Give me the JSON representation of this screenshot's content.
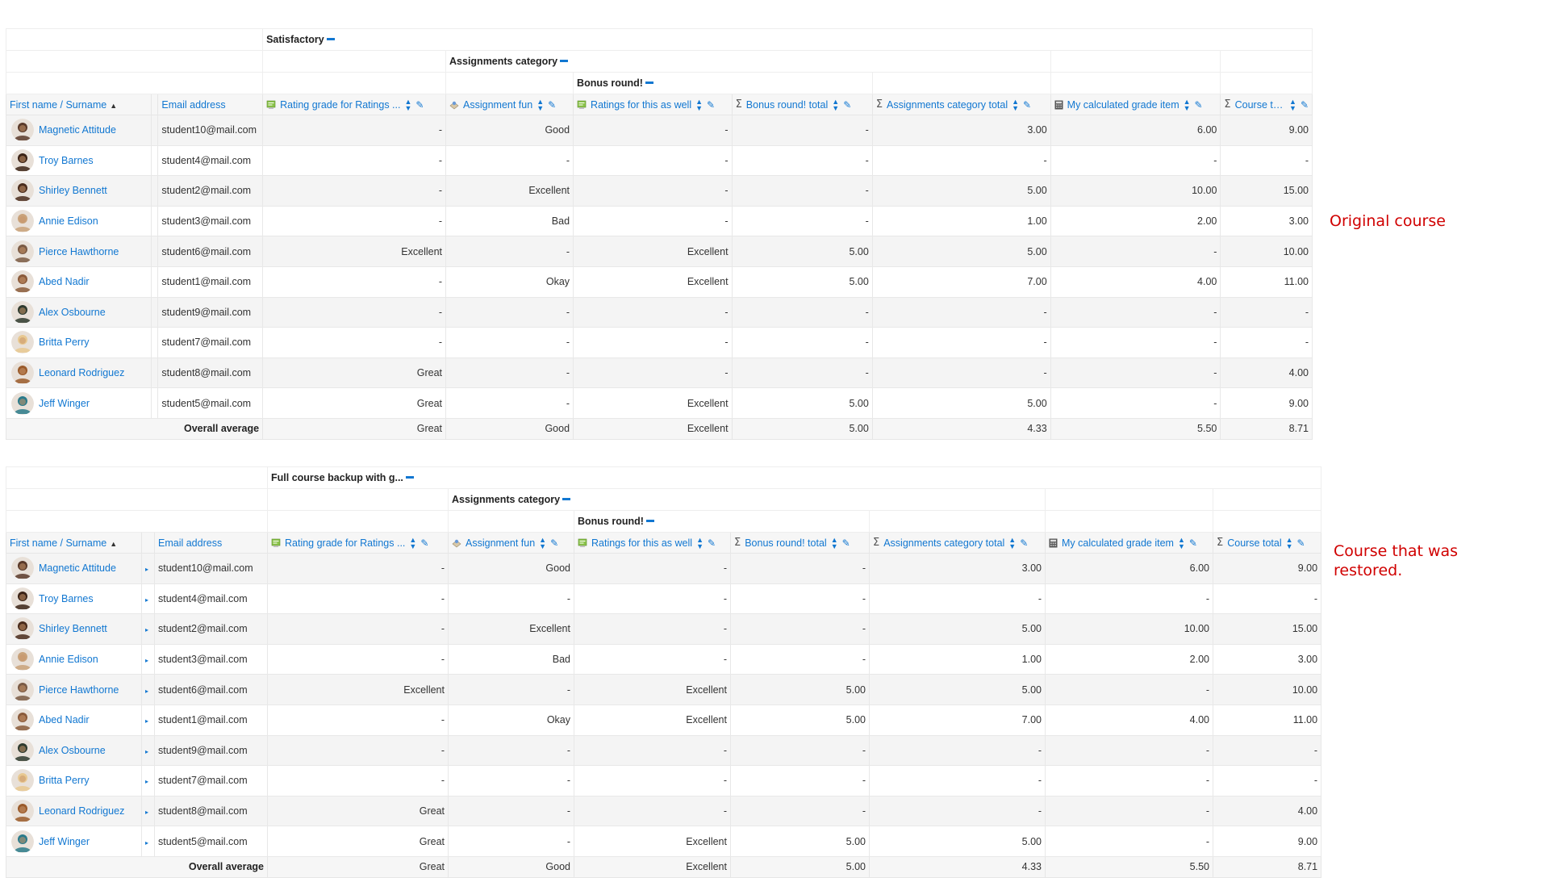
{
  "tables": [
    {
      "category_top": "Satisfactory",
      "category_mid": "Assignments category",
      "category_inner": "Bonus round!",
      "header_name": "First name / Surname",
      "header_email": "Email address",
      "columns": [
        "Rating grade for Ratings ...",
        "Assignment fun",
        "Ratings for this as well",
        "Bonus round! total",
        "Assignments category total",
        "My calculated grade item",
        "Course total"
      ],
      "average_label": "Overall average",
      "averages": [
        "Great",
        "Good",
        "Excellent",
        "5.00",
        "4.33",
        "5.50",
        "8.71"
      ],
      "note": "Original course",
      "rows": [
        {
          "name": "Magnetic Attitude",
          "email": "student10@mail.com",
          "grades": [
            "-",
            "Good",
            "-",
            "-",
            "3.00",
            "6.00",
            "9.00"
          ]
        },
        {
          "name": "Troy Barnes",
          "email": "student4@mail.com",
          "grades": [
            "-",
            "-",
            "-",
            "-",
            "-",
            "-",
            "-"
          ]
        },
        {
          "name": "Shirley Bennett",
          "email": "student2@mail.com",
          "grades": [
            "-",
            "Excellent",
            "-",
            "-",
            "5.00",
            "10.00",
            "15.00"
          ]
        },
        {
          "name": "Annie Edison",
          "email": "student3@mail.com",
          "grades": [
            "-",
            "Bad",
            "-",
            "-",
            "1.00",
            "2.00",
            "3.00"
          ]
        },
        {
          "name": "Pierce Hawthorne",
          "email": "student6@mail.com",
          "grades": [
            "Excellent",
            "-",
            "Excellent",
            "5.00",
            "5.00",
            "-",
            "10.00"
          ]
        },
        {
          "name": "Abed Nadir",
          "email": "student1@mail.com",
          "grades": [
            "-",
            "Okay",
            "Excellent",
            "5.00",
            "7.00",
            "4.00",
            "11.00"
          ]
        },
        {
          "name": "Alex Osbourne",
          "email": "student9@mail.com",
          "grades": [
            "-",
            "-",
            "-",
            "-",
            "-",
            "-",
            "-"
          ]
        },
        {
          "name": "Britta Perry",
          "email": "student7@mail.com",
          "grades": [
            "-",
            "-",
            "-",
            "-",
            "-",
            "-",
            "-"
          ]
        },
        {
          "name": "Leonard Rodriguez",
          "email": "student8@mail.com",
          "grades": [
            "Great",
            "-",
            "-",
            "-",
            "-",
            "-",
            "4.00"
          ]
        },
        {
          "name": "Jeff Winger",
          "email": "student5@mail.com",
          "grades": [
            "Great",
            "-",
            "Excellent",
            "5.00",
            "5.00",
            "-",
            "9.00"
          ]
        }
      ]
    },
    {
      "category_top": "Full course backup with g...",
      "category_mid": "Assignments category",
      "category_inner": "Bonus round!",
      "header_name": "First name / Surname",
      "header_email": "Email address",
      "columns": [
        "Rating grade for Ratings ...",
        "Assignment fun",
        "Ratings for this as well",
        "Bonus round! total",
        "Assignments category total",
        "My calculated grade item",
        "Course total"
      ],
      "average_label": "Overall average",
      "averages": [
        "Great",
        "Good",
        "Excellent",
        "5.00",
        "4.33",
        "5.50",
        "8.71"
      ],
      "note": "Course that was restored.",
      "rows": [
        {
          "name": "Magnetic Attitude",
          "email": "student10@mail.com",
          "grades": [
            "-",
            "Good",
            "-",
            "-",
            "3.00",
            "6.00",
            "9.00"
          ]
        },
        {
          "name": "Troy Barnes",
          "email": "student4@mail.com",
          "grades": [
            "-",
            "-",
            "-",
            "-",
            "-",
            "-",
            "-"
          ]
        },
        {
          "name": "Shirley Bennett",
          "email": "student2@mail.com",
          "grades": [
            "-",
            "Excellent",
            "-",
            "-",
            "5.00",
            "10.00",
            "15.00"
          ]
        },
        {
          "name": "Annie Edison",
          "email": "student3@mail.com",
          "grades": [
            "-",
            "Bad",
            "-",
            "-",
            "1.00",
            "2.00",
            "3.00"
          ]
        },
        {
          "name": "Pierce Hawthorne",
          "email": "student6@mail.com",
          "grades": [
            "Excellent",
            "-",
            "Excellent",
            "5.00",
            "5.00",
            "-",
            "10.00"
          ]
        },
        {
          "name": "Abed Nadir",
          "email": "student1@mail.com",
          "grades": [
            "-",
            "Okay",
            "Excellent",
            "5.00",
            "7.00",
            "4.00",
            "11.00"
          ]
        },
        {
          "name": "Alex Osbourne",
          "email": "student9@mail.com",
          "grades": [
            "-",
            "-",
            "-",
            "-",
            "-",
            "-",
            "-"
          ]
        },
        {
          "name": "Britta Perry",
          "email": "student7@mail.com",
          "grades": [
            "-",
            "-",
            "-",
            "-",
            "-",
            "-",
            "-"
          ]
        },
        {
          "name": "Leonard Rodriguez",
          "email": "student8@mail.com",
          "grades": [
            "Great",
            "-",
            "-",
            "-",
            "-",
            "-",
            "4.00"
          ]
        },
        {
          "name": "Jeff Winger",
          "email": "student5@mail.com",
          "grades": [
            "Great",
            "-",
            "Excellent",
            "5.00",
            "5.00",
            "-",
            "9.00"
          ]
        }
      ]
    }
  ],
  "avatar_colors": [
    "#5a3a2a",
    "#3b2316",
    "#4a2c1c",
    "#c9a27a",
    "#7a5a44",
    "#8a5a3a",
    "#2e3a2e",
    "#e8c890",
    "#9a5a2a",
    "#2a7a8a"
  ],
  "column_icons": [
    "rating-icon",
    "assignment-icon",
    "rating-icon",
    "sigma-icon",
    "sigma-icon",
    "calculator-icon",
    "sigma-icon"
  ]
}
